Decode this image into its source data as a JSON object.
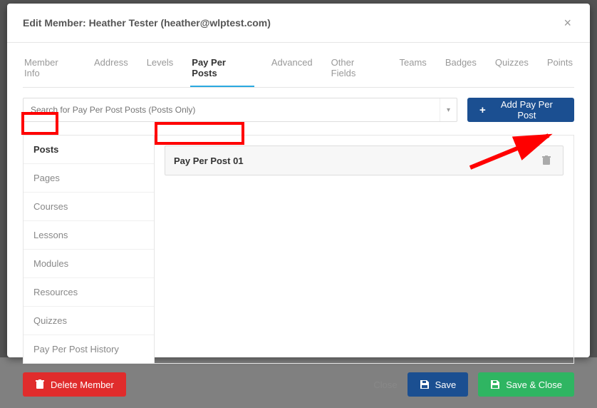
{
  "modal": {
    "title": "Edit Member: Heather Tester (heather@wlptest.com)"
  },
  "tabs": [
    {
      "label": "Member Info",
      "active": false
    },
    {
      "label": "Address",
      "active": false
    },
    {
      "label": "Levels",
      "active": false
    },
    {
      "label": "Pay Per Posts",
      "active": true
    },
    {
      "label": "Advanced",
      "active": false
    },
    {
      "label": "Other Fields",
      "active": false
    },
    {
      "label": "Teams",
      "active": false
    },
    {
      "label": "Badges",
      "active": false
    },
    {
      "label": "Quizzes",
      "active": false
    },
    {
      "label": "Points",
      "active": false
    }
  ],
  "search": {
    "placeholder": "Search for Pay Per Post Posts (Posts Only)"
  },
  "buttons": {
    "add": "Add Pay Per Post",
    "delete": "Delete Member",
    "close": "Close",
    "save": "Save",
    "save_close": "Save & Close"
  },
  "categories": [
    {
      "label": "Posts",
      "active": true
    },
    {
      "label": "Pages",
      "active": false
    },
    {
      "label": "Courses",
      "active": false
    },
    {
      "label": "Lessons",
      "active": false
    },
    {
      "label": "Modules",
      "active": false
    },
    {
      "label": "Resources",
      "active": false
    },
    {
      "label": "Quizzes",
      "active": false
    },
    {
      "label": "Pay Per Post History",
      "active": false
    }
  ],
  "records": [
    {
      "label": "Pay Per Post 01"
    }
  ]
}
